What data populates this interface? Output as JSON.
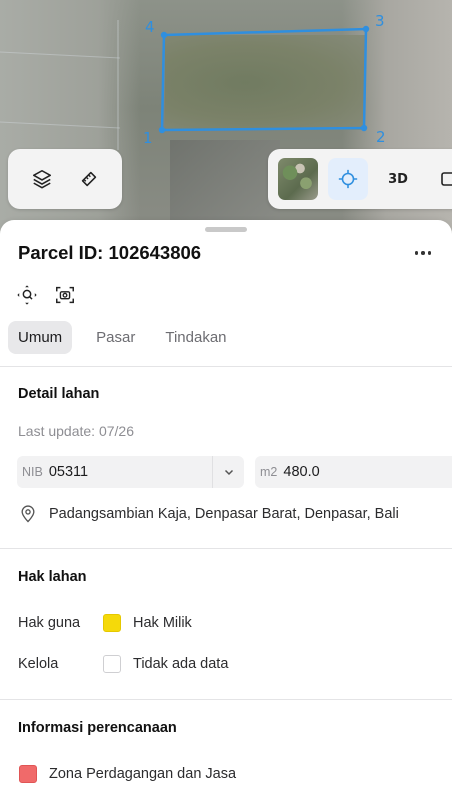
{
  "map": {
    "vertex_labels": [
      "1",
      "2",
      "3",
      "4"
    ],
    "parcel_outline_color": "#2f8fdf",
    "left_controls": [
      {
        "icon": "layers-icon"
      },
      {
        "icon": "measure-icon"
      }
    ],
    "right_controls": {
      "basemap_thumbnail": "satellite-thumbnail",
      "locate_icon": "crosshair-icon",
      "label_3d": "3D",
      "cutoff_icon": "square-icon"
    }
  },
  "sheet": {
    "title": "Parcel ID: 102643806",
    "more_icon": "more-horizontal-icon",
    "action_icons": [
      "zoom-to-parcel-icon",
      "screenshot-icon"
    ]
  },
  "tabs": [
    {
      "label": "Umum",
      "active": true
    },
    {
      "label": "Pasar",
      "active": false
    },
    {
      "label": "Tindakan",
      "active": false
    }
  ],
  "detail": {
    "heading": "Detail lahan",
    "last_update": "Last update: 07/26",
    "nib_prefix": "NIB",
    "nib_value": "05311",
    "area_prefix": "m2",
    "area_value": "480.0",
    "address": "Padangsambian Kaja, Denpasar Barat, Denpasar, Bali"
  },
  "rights": {
    "heading": "Hak lahan",
    "rows": [
      {
        "label": "Hak guna",
        "value": "Hak Milik",
        "swatch_color": "#f5d90a"
      },
      {
        "label": "Kelola",
        "value": "Tidak ada data",
        "swatch_color": "#ffffff"
      }
    ]
  },
  "planning": {
    "heading": "Informasi perencanaan",
    "zone": "Zona Perdagangan dan Jasa",
    "zone_color": "#f06a6a"
  }
}
